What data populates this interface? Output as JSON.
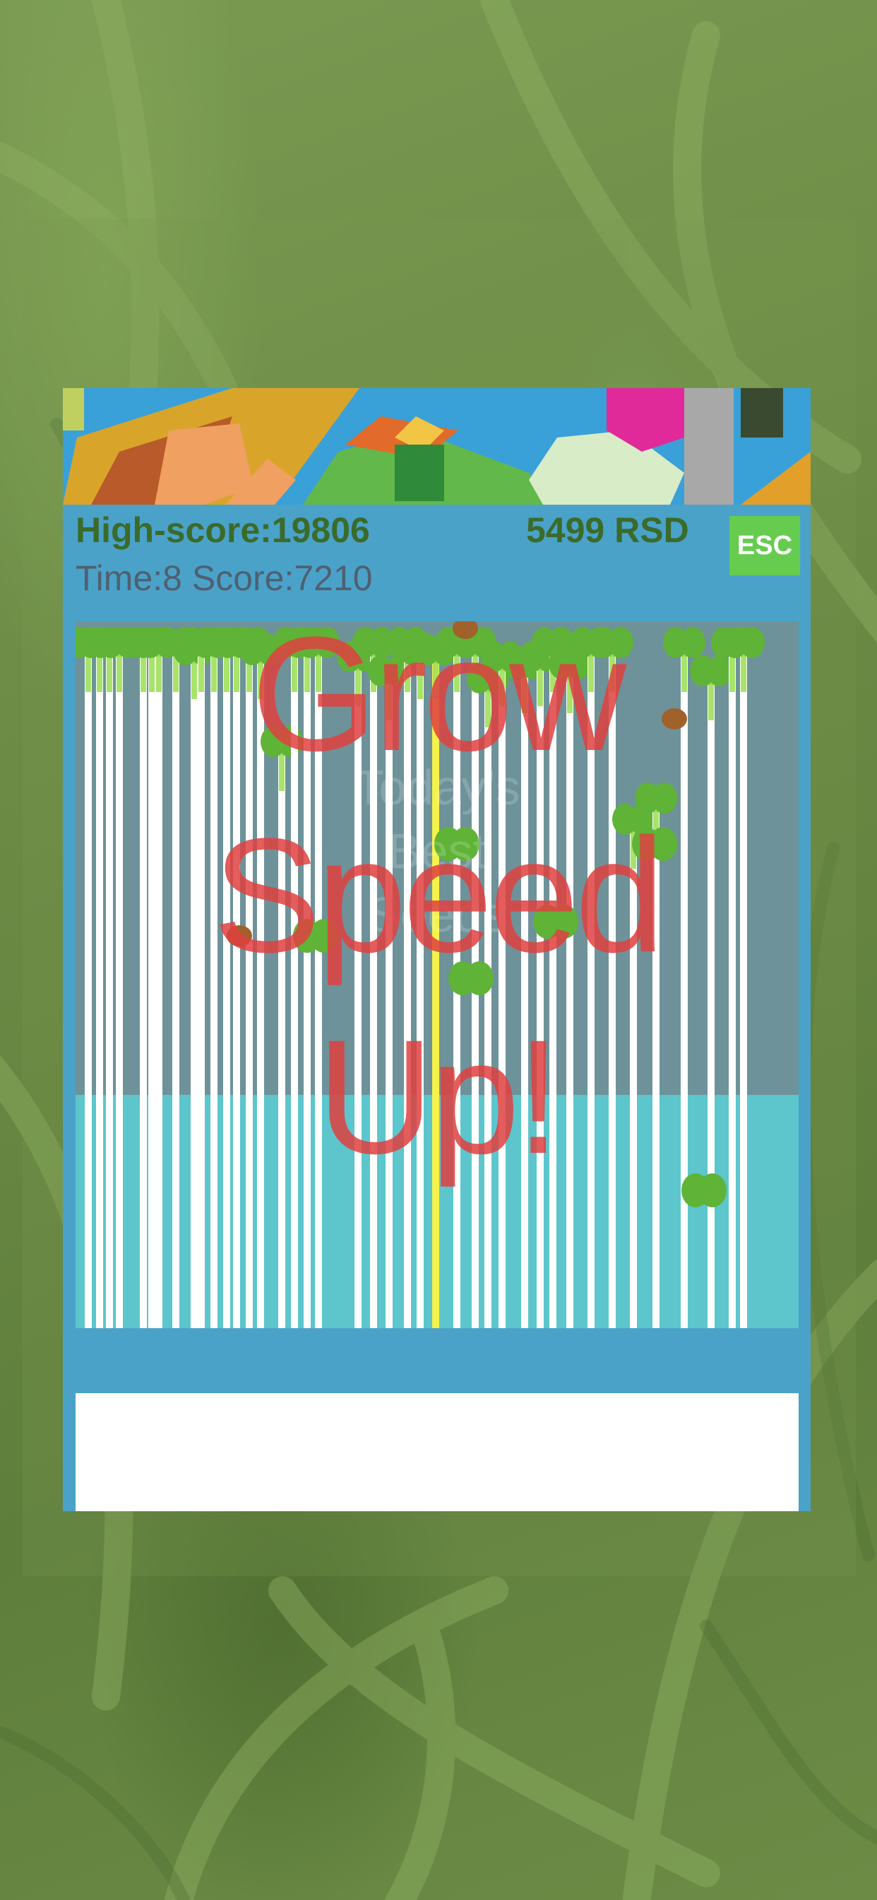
{
  "hud": {
    "high_score": "High-score:19806",
    "money": "5499 RSD",
    "time_score": "Time:8 Score:7210",
    "esc_label": "ESC"
  },
  "overlay": {
    "grow_lines": [
      "Grow",
      "Speed",
      "Up!"
    ],
    "ghost_lines": [
      "Today's",
      "Best",
      "Seeds"
    ]
  },
  "icons": {
    "sprout": "sprout-icon",
    "seed": "seed-icon",
    "background": "grass-background"
  },
  "colors": {
    "panel": "#4aa2c9",
    "stem": "#ffffff",
    "highlight_stem": "#f5f24a",
    "leaf": "#5fb336",
    "seed": "#a0612a",
    "overlay_text": "#e04040",
    "esc": "#66cc4f"
  }
}
